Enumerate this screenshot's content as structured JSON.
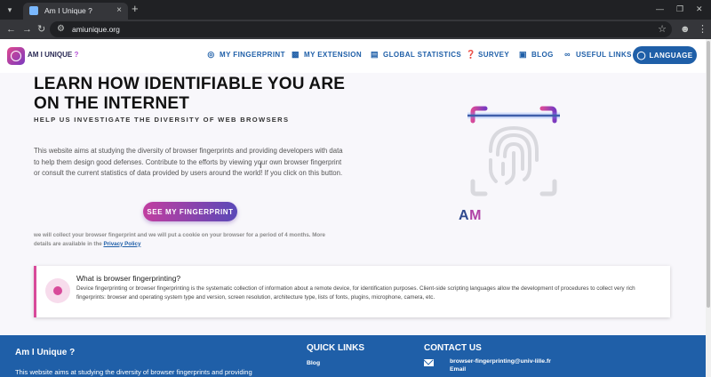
{
  "browser": {
    "tab_title": "Am I Unique ?",
    "url": "amiunique.org",
    "icons": [
      "tab-list-icon",
      "favicon-icon",
      "close-icon",
      "new-tab-icon",
      "back-icon",
      "forward-icon",
      "reload-icon",
      "site-info-icon",
      "star-icon",
      "profile-icon",
      "kebab-menu-icon"
    ]
  },
  "header": {
    "brand": "AM I UNIQUE",
    "brand_suffix": "?",
    "menu": [
      {
        "label": "MY FINGERPRINT",
        "icon": "fingerprint-icon"
      },
      {
        "label": "MY EXTENSION",
        "icon": "puzzle-icon"
      },
      {
        "label": "GLOBAL STATISTICS",
        "icon": "bar-chart-icon"
      },
      {
        "label": "SURVEY",
        "icon": "help-icon"
      },
      {
        "label": "BLOG",
        "icon": "blog-icon"
      },
      {
        "label": "USEFUL LINKS",
        "icon": "link-icon"
      }
    ],
    "language": {
      "label": "LANGUAGE",
      "icon": "globe-icon"
    }
  },
  "hero": {
    "title": "LEARN HOW IDENTIFIABLE YOU ARE ON THE INTERNET",
    "subtitle": "HELP US INVESTIGATE THE DIVERSITY OF WEB BROWSERS",
    "description": "This website aims at studying the diversity of browser fingerprints and providing developers with data to help them design good defenses. Contribute to the efforts by viewing your own browser fingerprint or consult the current statistics of data provided by users around the world! If you click on this button.",
    "cta": "SEE MY FINGERPRINT",
    "cookie_note": "we will collect your browser fingerprint and we will put a cookie on your browser for a period of 4 months. More details are available in the",
    "privacy_link": "Privacy Policy",
    "logo_letters": [
      "A",
      "M"
    ]
  },
  "info": {
    "title": "What is browser fingerprinting?",
    "text": "Device fingerprinting or browser fingerprinting is the systematic collection of information about a remote device, for identification purposes. Client-side scripting languages allow the development of procedures to collect very rich fingerprints: browser and operating system type and version, screen resolution, architecture type, lists of fonts, plugins, microphone, camera, etc."
  },
  "footer": {
    "title": "Am I Unique ?",
    "description": "This website aims at studying the diversity of browser fingerprints and providing",
    "quick_links_heading": "QUICK LINKS",
    "quick_links": [
      "Blog"
    ],
    "contact_heading": "CONTACT US",
    "email": "browser-fingerprinting@univ-lille.fr",
    "email_label": "Email"
  },
  "colors": {
    "primary": "#1f5fa8",
    "accent": "#d84a9a",
    "purple": "#7a3ac0"
  }
}
